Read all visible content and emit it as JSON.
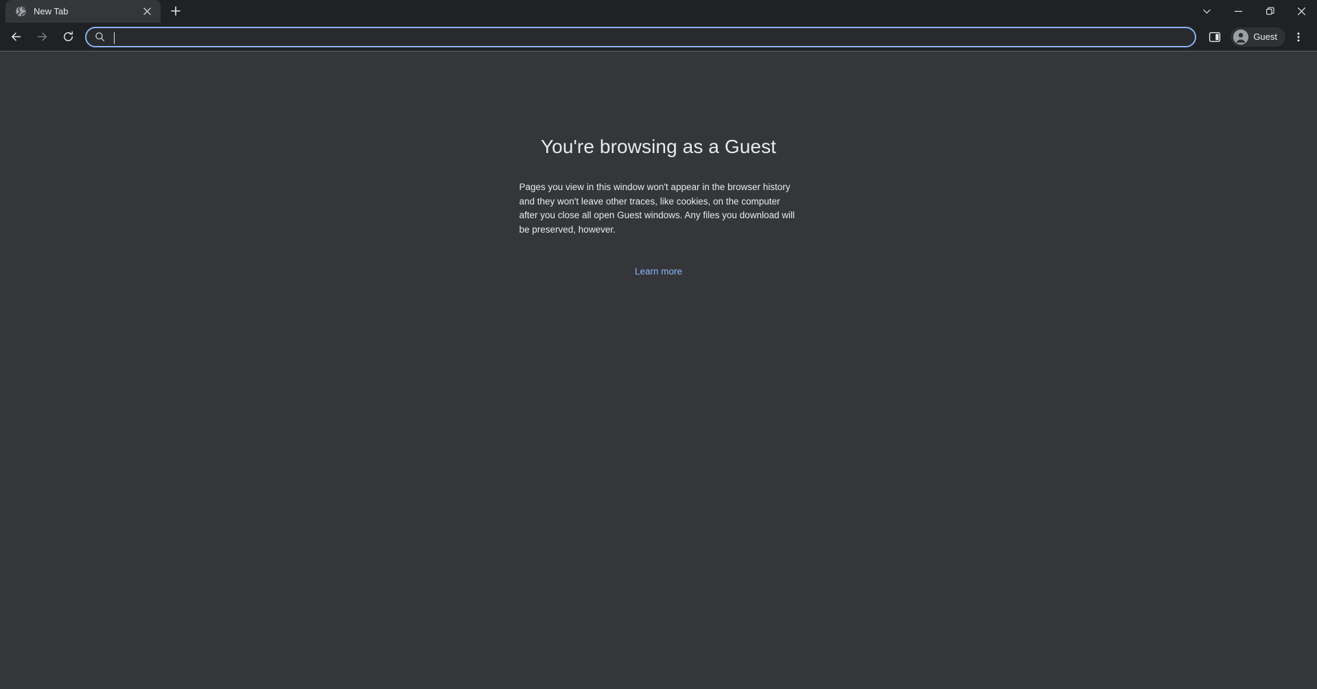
{
  "window": {
    "controls": [
      {
        "name": "tab-search",
        "icon": "chevron-down-icon",
        "label": "Search tabs"
      },
      {
        "name": "minimize",
        "icon": "minimize-icon",
        "label": "Minimize"
      },
      {
        "name": "maximize",
        "icon": "restore-icon",
        "label": "Maximize"
      },
      {
        "name": "close",
        "icon": "close-icon",
        "label": "Close"
      }
    ]
  },
  "tabstrip": {
    "tabs": [
      {
        "title": "New Tab",
        "favicon": "globe-icon",
        "close_label": "Close tab",
        "active": true
      }
    ],
    "new_tab_label": "New tab"
  },
  "toolbar": {
    "back_label": "Back",
    "forward_label": "Forward",
    "reload_label": "Reload",
    "side_panel_label": "Show side panel",
    "menu_label": "Customize and control Google Chrome",
    "omnibox": {
      "value": "",
      "placeholder": "",
      "icon": "search-icon"
    },
    "profile": {
      "name": "Guest",
      "avatar_icon": "person-icon"
    }
  },
  "page": {
    "title": "You're browsing as a Guest",
    "body": "Pages you view in this window won't appear in the browser history and they won't leave other traces, like cookies, on the computer after you close all open Guest windows. Any files you download will be preserved, however.",
    "learn_more": "Learn more"
  },
  "colors": {
    "frame": "#202124",
    "tab_active": "#35363a",
    "page_bg": "#35363a",
    "omnibox_bg": "#292a2d",
    "accent": "#8ab4f8",
    "text": "#e8eaed",
    "text_dim": "#9aa0a6"
  }
}
